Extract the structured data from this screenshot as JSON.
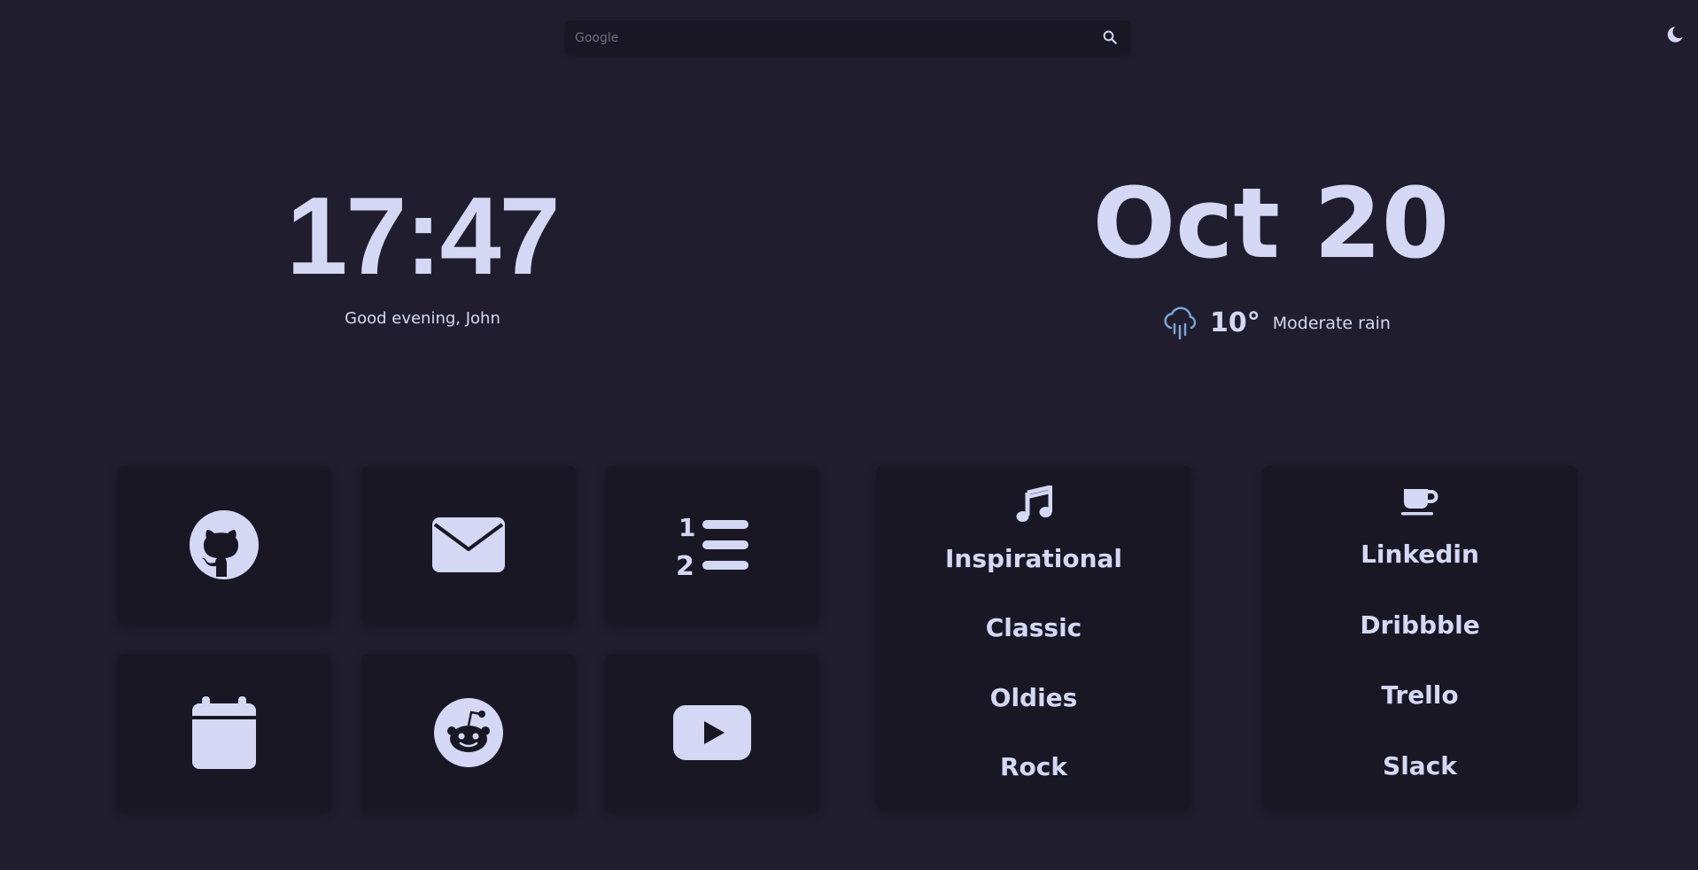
{
  "search": {
    "placeholder": "Google"
  },
  "clock": {
    "time": "17:47",
    "greeting": "Good evening, John"
  },
  "date": {
    "text": "Oct 20"
  },
  "weather": {
    "temperature": "10°",
    "description": "Moderate rain",
    "icon": "cloud-rain-icon"
  },
  "shortcuts": [
    {
      "icon": "github-icon"
    },
    {
      "icon": "mail-icon"
    },
    {
      "icon": "list-ordered-icon"
    },
    {
      "icon": "calendar-icon"
    },
    {
      "icon": "reddit-icon"
    },
    {
      "icon": "youtube-icon"
    }
  ],
  "music_list": {
    "icon": "music-note-icon",
    "items": [
      "Inspirational",
      "Classic",
      "Oldies",
      "Rock"
    ]
  },
  "work_list": {
    "icon": "coffee-icon",
    "items": [
      "Linkedin",
      "Dribbble",
      "Trello",
      "Slack"
    ]
  },
  "colors": {
    "background": "#201e2e",
    "card": "#191724",
    "text": "#d4d8f4",
    "weather_icon": "#7aa5d8"
  }
}
